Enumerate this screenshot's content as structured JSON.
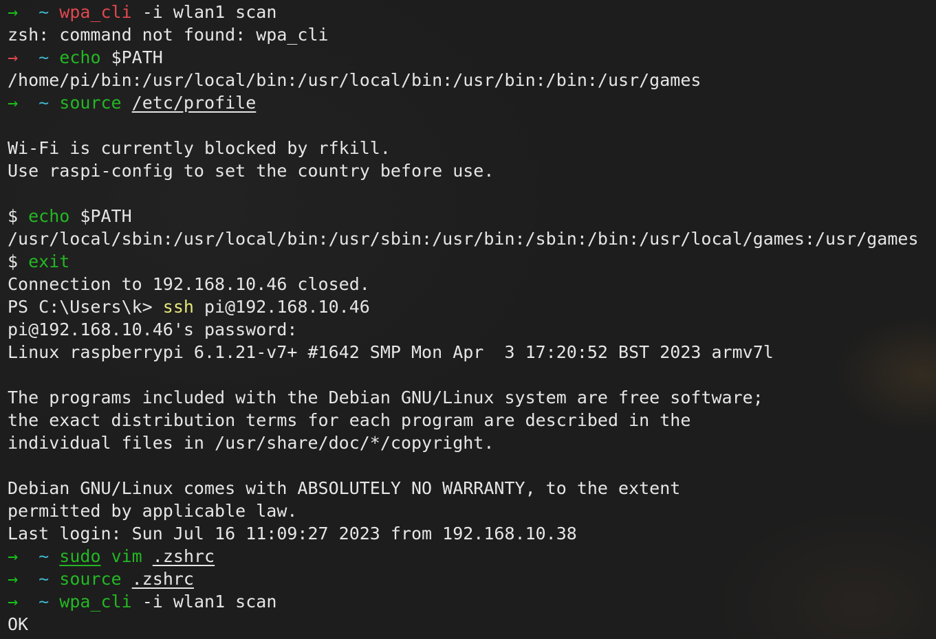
{
  "terminal": {
    "lines": [
      {
        "prompt_arrow": "→",
        "prompt_tilde": "~",
        "cmd": "wpa_cli",
        "args": " -i wlan1 scan"
      },
      {
        "text": "zsh: command not found: wpa_cli"
      },
      {
        "prompt_arrow": "→",
        "prompt_tilde": "~",
        "cmd": "echo",
        "args": " $PATH"
      },
      {
        "text": "/home/pi/bin:/usr/local/bin:/usr/local/bin:/usr/bin:/bin:/usr/games"
      },
      {
        "prompt_arrow": "→",
        "prompt_tilde": "~",
        "cmd": "source",
        "arg_underlined": "/etc/profile"
      },
      {
        "text": ""
      },
      {
        "text": "Wi-Fi is currently blocked by rfkill."
      },
      {
        "text": "Use raspi-config to set the country before use."
      },
      {
        "text": ""
      },
      {
        "dollar": "$",
        "cmd": "echo",
        "args": " $PATH"
      },
      {
        "text": "/usr/local/sbin:/usr/local/bin:/usr/sbin:/usr/bin:/sbin:/bin:/usr/local/games:/usr/games"
      },
      {
        "dollar": "$",
        "cmd": "exit"
      },
      {
        "text": "Connection to 192.168.10.46 closed."
      },
      {
        "ps_prompt": "PS C:\\Users\\k>",
        "cmd": "ssh",
        "args": " pi@192.168.10.46"
      },
      {
        "text": "pi@192.168.10.46's password:"
      },
      {
        "text": "Linux raspberrypi 6.1.21-v7+ #1642 SMP Mon Apr  3 17:20:52 BST 2023 armv7l"
      },
      {
        "text": ""
      },
      {
        "text": "The programs included with the Debian GNU/Linux system are free software;"
      },
      {
        "text": "the exact distribution terms for each program are described in the"
      },
      {
        "text": "individual files in /usr/share/doc/*/copyright."
      },
      {
        "text": ""
      },
      {
        "text": "Debian GNU/Linux comes with ABSOLUTELY NO WARRANTY, to the extent"
      },
      {
        "text": "permitted by applicable law."
      },
      {
        "text": "Last login: Sun Jul 16 11:09:27 2023 from 192.168.10.38"
      },
      {
        "prompt_arrow": "→",
        "prompt_tilde": "~",
        "cmd_underlined": "sudo",
        "cmd2": "vim",
        "arg_underlined": ".zshrc"
      },
      {
        "prompt_arrow": "→",
        "prompt_tilde": "~",
        "cmd": "source",
        "arg_underlined": ".zshrc"
      },
      {
        "prompt_arrow": "→",
        "prompt_tilde": "~",
        "cmd": "wpa_cli",
        "args": " -i wlan1 scan"
      },
      {
        "text": "OK"
      }
    ]
  },
  "colors": {
    "background": "#1d1d1d",
    "text": "#e6e6e6",
    "prompt_arrow_error": "#e0484e",
    "prompt_arrow_ok": "#19c01a",
    "prompt_tilde": "#41b8cf",
    "command_not_found": "#e0484e",
    "command_found": "#23b823",
    "powershell_command": "#e6e67a"
  }
}
